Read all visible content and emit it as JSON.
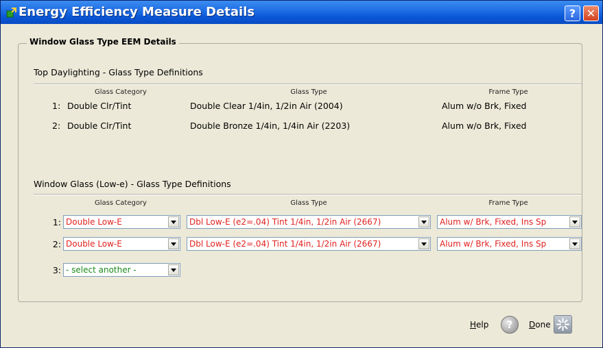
{
  "window": {
    "title": "Energy Efficiency Measure Details",
    "help_button": "?",
    "close_button": "✕"
  },
  "group": {
    "title": "Window Glass Type EEM Details"
  },
  "top_daylighting": {
    "section_title": "Top Daylighting  - Glass Type Definitions",
    "headers": {
      "category": "Glass Category",
      "glass_type": "Glass Type",
      "frame_type": "Frame Type"
    },
    "rows": [
      {
        "num": "1:",
        "category": "Double Clr/Tint",
        "glass_type": "Double Clear 1/4in, 1/2in Air (2004)",
        "frame_type": "Alum w/o Brk, Fixed"
      },
      {
        "num": "2:",
        "category": "Double Clr/Tint",
        "glass_type": "Double Bronze 1/4in, 1/4in Air (2203)",
        "frame_type": "Alum w/o Brk, Fixed"
      }
    ]
  },
  "window_glass": {
    "section_title": "Window Glass (Low-e)  - Glass Type Definitions",
    "headers": {
      "category": "Glass Category",
      "glass_type": "Glass Type",
      "frame_type": "Frame Type"
    },
    "rows": [
      {
        "num": "1:",
        "category": "Double Low-E",
        "glass_type": "Dbl Low-E (e2=.04) Tint 1/4in, 1/2in Air (2667)",
        "frame_type": "Alum w/ Brk, Fixed, Ins Sp"
      },
      {
        "num": "2:",
        "category": "Double Low-E",
        "glass_type": "Dbl Low-E (e2=.04) Tint 1/4in, 1/2in Air (2667)",
        "frame_type": "Alum w/ Brk, Fixed, Ins Sp"
      }
    ],
    "add_row": {
      "num": "3:",
      "category": "- select another -"
    }
  },
  "footer": {
    "help_label_u": "H",
    "help_label_rest": "elp",
    "help_icon": "?",
    "done_label_u": "D",
    "done_label_rest": "one"
  },
  "colors": {
    "selected_value": "#e0211e",
    "select_another": "#1a8a1a",
    "titlebar": "#0a57d6"
  }
}
